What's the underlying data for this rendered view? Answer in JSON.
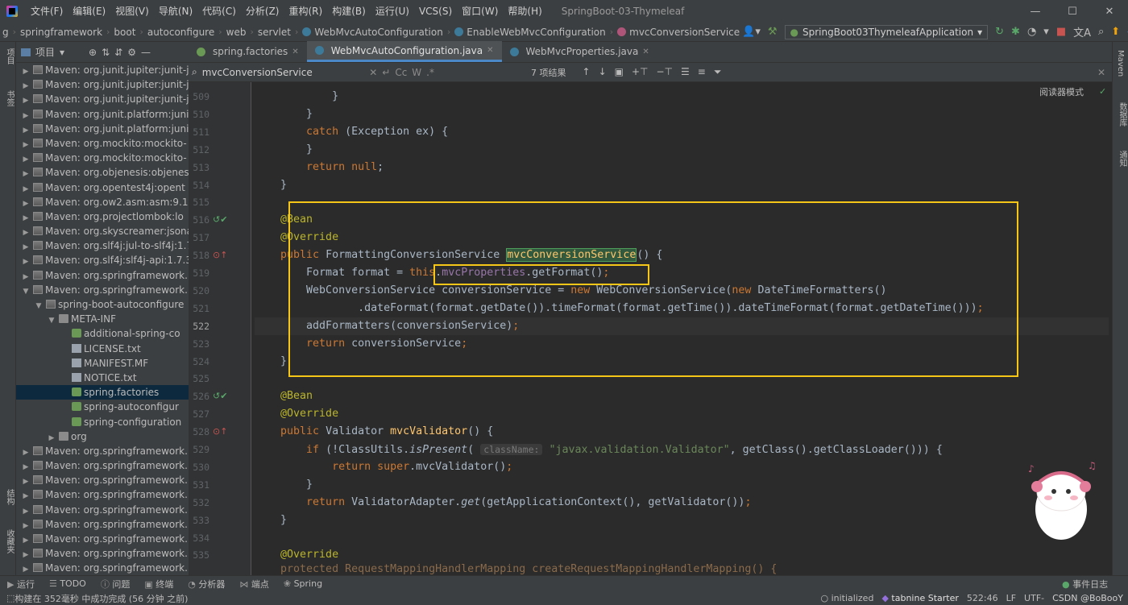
{
  "menu": [
    "文件(F)",
    "编辑(E)",
    "视图(V)",
    "导航(N)",
    "代码(C)",
    "分析(Z)",
    "重构(R)",
    "构建(B)",
    "运行(U)",
    "VCS(S)",
    "窗口(W)",
    "帮助(H)"
  ],
  "window_title": "SpringBoot-03-Thymeleaf",
  "window_controls": {
    "minimize": "—",
    "maximize": "☐",
    "close": "✕"
  },
  "breadcrumb": [
    "g",
    "springframework",
    "boot",
    "autoconfigure",
    "web",
    "servlet",
    "WebMvcAutoConfiguration",
    "EnableWebMvcConfiguration",
    "mvcConversionService"
  ],
  "run_config": "SpringBoot03ThymeleafApplication",
  "project_panel": {
    "title": "项目"
  },
  "left_stripe": {
    "top": "项目",
    "mid": "书签",
    "bottom1": "结构",
    "bottom2": "收藏夹"
  },
  "right_stripe": {
    "a": "Maven",
    "b": "数据库",
    "c": "通知"
  },
  "tree": [
    {
      "indent": 1,
      "arrow": "▶",
      "icon": "lib",
      "label": "Maven: org.junit.jupiter:junit-j"
    },
    {
      "indent": 1,
      "arrow": "▶",
      "icon": "lib",
      "label": "Maven: org.junit.jupiter:junit-j"
    },
    {
      "indent": 1,
      "arrow": "▶",
      "icon": "lib",
      "label": "Maven: org.junit.jupiter:junit-j"
    },
    {
      "indent": 1,
      "arrow": "▶",
      "icon": "lib",
      "label": "Maven: org.junit.platform:juni"
    },
    {
      "indent": 1,
      "arrow": "▶",
      "icon": "lib",
      "label": "Maven: org.junit.platform:juni"
    },
    {
      "indent": 1,
      "arrow": "▶",
      "icon": "lib",
      "label": "Maven: org.mockito:mockito-"
    },
    {
      "indent": 1,
      "arrow": "▶",
      "icon": "lib",
      "label": "Maven: org.mockito:mockito-"
    },
    {
      "indent": 1,
      "arrow": "▶",
      "icon": "lib",
      "label": "Maven: org.objenesis:objenes"
    },
    {
      "indent": 1,
      "arrow": "▶",
      "icon": "lib",
      "label": "Maven: org.opentest4j:opent"
    },
    {
      "indent": 1,
      "arrow": "▶",
      "icon": "lib",
      "label": "Maven: org.ow2.asm:asm:9.1"
    },
    {
      "indent": 1,
      "arrow": "▶",
      "icon": "lib",
      "label": "Maven: org.projectlombok:lo"
    },
    {
      "indent": 1,
      "arrow": "▶",
      "icon": "lib",
      "label": "Maven: org.skyscreamer:jsona"
    },
    {
      "indent": 1,
      "arrow": "▶",
      "icon": "lib",
      "label": "Maven: org.slf4j:jul-to-slf4j:1.7"
    },
    {
      "indent": 1,
      "arrow": "▶",
      "icon": "lib",
      "label": "Maven: org.slf4j:slf4j-api:1.7.3"
    },
    {
      "indent": 1,
      "arrow": "▶",
      "icon": "lib",
      "label": "Maven: org.springframework."
    },
    {
      "indent": 1,
      "arrow": "▼",
      "icon": "lib",
      "label": "Maven: org.springframework."
    },
    {
      "indent": 2,
      "arrow": "▼",
      "icon": "lib",
      "label": "spring-boot-autoconfigure"
    },
    {
      "indent": 3,
      "arrow": "▼",
      "icon": "folder",
      "label": "META-INF"
    },
    {
      "indent": 4,
      "arrow": "",
      "icon": "spring",
      "label": "additional-spring-co"
    },
    {
      "indent": 4,
      "arrow": "",
      "icon": "file",
      "label": "LICENSE.txt"
    },
    {
      "indent": 4,
      "arrow": "",
      "icon": "file",
      "label": "MANIFEST.MF"
    },
    {
      "indent": 4,
      "arrow": "",
      "icon": "file",
      "label": "NOTICE.txt"
    },
    {
      "indent": 4,
      "arrow": "",
      "icon": "spring",
      "label": "spring.factories",
      "selected": true
    },
    {
      "indent": 4,
      "arrow": "",
      "icon": "spring",
      "label": "spring-autoconfigur"
    },
    {
      "indent": 4,
      "arrow": "",
      "icon": "spring",
      "label": "spring-configuration"
    },
    {
      "indent": 3,
      "arrow": "▶",
      "icon": "folder",
      "label": "org"
    },
    {
      "indent": 1,
      "arrow": "▶",
      "icon": "lib",
      "label": "Maven: org.springframework."
    },
    {
      "indent": 1,
      "arrow": "▶",
      "icon": "lib",
      "label": "Maven: org.springframework."
    },
    {
      "indent": 1,
      "arrow": "▶",
      "icon": "lib",
      "label": "Maven: org.springframework."
    },
    {
      "indent": 1,
      "arrow": "▶",
      "icon": "lib",
      "label": "Maven: org.springframework."
    },
    {
      "indent": 1,
      "arrow": "▶",
      "icon": "lib",
      "label": "Maven: org.springframework."
    },
    {
      "indent": 1,
      "arrow": "▶",
      "icon": "lib",
      "label": "Maven: org.springframework."
    },
    {
      "indent": 1,
      "arrow": "▶",
      "icon": "lib",
      "label": "Maven: org.springframework."
    },
    {
      "indent": 1,
      "arrow": "▶",
      "icon": "lib",
      "label": "Maven: org.springframework."
    },
    {
      "indent": 1,
      "arrow": "▶",
      "icon": "lib",
      "label": "Maven: org.springframework."
    }
  ],
  "tabs": [
    {
      "label": "spring.factories",
      "active": false
    },
    {
      "label": "WebMvcAutoConfiguration.java",
      "active": true
    },
    {
      "label": "WebMvcProperties.java",
      "active": false
    }
  ],
  "find": {
    "query": "mvcConversionService",
    "options": [
      "Cc",
      "W",
      ".*"
    ],
    "count": "7 项结果"
  },
  "reader_mode": "阅读器模式",
  "current_line": 522,
  "line_numbers": [
    509,
    510,
    511,
    512,
    513,
    514,
    515,
    516,
    517,
    518,
    519,
    520,
    521,
    522,
    523,
    524,
    525,
    526,
    527,
    528,
    529,
    530,
    531,
    532,
    533,
    534,
    535
  ],
  "code_lines": [
    [
      [
        "p",
        "            }"
      ]
    ],
    [
      [
        "p",
        "        }"
      ]
    ],
    [
      [
        "k",
        "        catch"
      ],
      [
        "p",
        " (Exception ex) {"
      ]
    ],
    [
      [
        "p",
        "        }"
      ]
    ],
    [
      [
        "k",
        "        return null"
      ],
      [
        "p",
        ";"
      ]
    ],
    [
      [
        "p",
        "    }"
      ]
    ],
    [
      [
        "p",
        ""
      ]
    ],
    [
      [
        "a",
        "    @Bean"
      ]
    ],
    [
      [
        "a",
        "    @Override"
      ]
    ],
    [
      [
        "k",
        "    public "
      ],
      [
        "p",
        "FormattingConversionService "
      ],
      [
        "m",
        "mvcConversionService"
      ],
      [
        "p",
        "() {"
      ]
    ],
    [
      [
        "p",
        "        Format format = "
      ],
      [
        "k",
        "this"
      ],
      [
        "p",
        "."
      ],
      [
        "f",
        "mvcProperties"
      ],
      [
        "p",
        ".getFormat()"
      ],
      [
        "k",
        ";"
      ]
    ],
    [
      [
        "p",
        "        WebConversionService conversionService = "
      ],
      [
        "k",
        "new "
      ],
      [
        "p",
        "WebConversionService("
      ],
      [
        "k",
        "new "
      ],
      [
        "p",
        "DateTimeFormatters()"
      ]
    ],
    [
      [
        "p",
        "                .dateFormat(format.getDate()).timeFormat(format.getTime()).dateTimeFormat(format.getDateTime()))"
      ],
      [
        "k",
        ";"
      ]
    ],
    [
      [
        "p",
        "        addFormatters(conversionService)"
      ],
      [
        "k",
        ";"
      ]
    ],
    [
      [
        "k",
        "        return "
      ],
      [
        "p",
        "conversionService"
      ],
      [
        "k",
        ";"
      ]
    ],
    [
      [
        "p",
        "    }"
      ]
    ],
    [
      [
        "p",
        ""
      ]
    ],
    [
      [
        "a",
        "    @Bean"
      ]
    ],
    [
      [
        "a",
        "    @Override"
      ]
    ],
    [
      [
        "k",
        "    public "
      ],
      [
        "p",
        "Validator "
      ],
      [
        "n",
        "mvcValidator"
      ],
      [
        "p",
        "() {"
      ]
    ],
    [
      [
        "k",
        "        if "
      ],
      [
        "p",
        "(!ClassUtils."
      ],
      [
        "i",
        "isPresent"
      ],
      [
        "p",
        "( "
      ],
      [
        "h",
        "className:"
      ],
      [
        "s",
        " \"javax.validation.Validator\""
      ],
      [
        "p",
        ", getClass().getClassLoader())) {"
      ]
    ],
    [
      [
        "k",
        "            return super"
      ],
      [
        "p",
        ".mvcValidator()"
      ],
      [
        "k",
        ";"
      ]
    ],
    [
      [
        "p",
        "        }"
      ]
    ],
    [
      [
        "k",
        "        return "
      ],
      [
        "p",
        "ValidatorAdapter."
      ],
      [
        "i",
        "get"
      ],
      [
        "p",
        "(getApplicationContext(), getValidator())"
      ],
      [
        "k",
        ";"
      ]
    ],
    [
      [
        "p",
        "    }"
      ]
    ],
    [
      [
        "p",
        ""
      ]
    ],
    [
      [
        "a",
        "    @Override"
      ]
    ]
  ],
  "last_line_partial": "    protected RequestMappingHandlerMapping createRequestMappingHandlerMapping() {",
  "bottom_tools": [
    "运行",
    "TODO",
    "问题",
    "终端",
    "分析器",
    "端点",
    "Spring"
  ],
  "event_log": "事件日志",
  "status": {
    "build": "构建在 352毫秒 中成功完成 (56 分钟 之前)",
    "initialized": "initialized",
    "tabnine": "tabnine Starter",
    "position": "522:46",
    "line_sep": "LF",
    "encoding": "UTF-",
    "watermark": "CSDN @BoBooY"
  }
}
